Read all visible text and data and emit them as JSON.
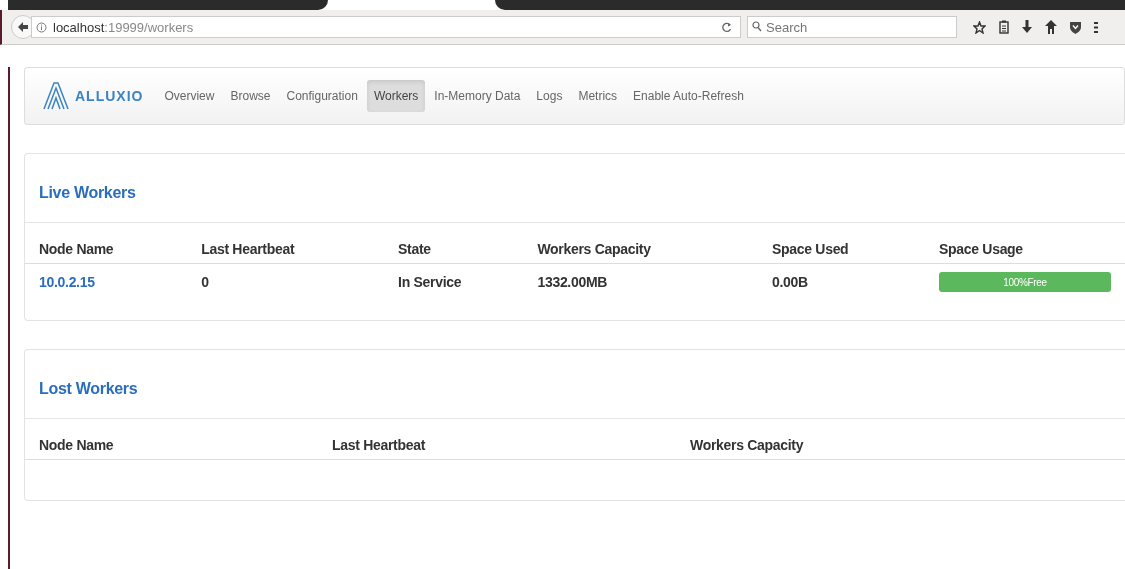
{
  "browser": {
    "url_host": "localhost",
    "url_path": ":19999/workers",
    "search": {
      "placeholder": "Search"
    }
  },
  "navbar": {
    "brand": "ALLUXIO",
    "items": [
      {
        "label": "Overview",
        "selected": false
      },
      {
        "label": "Browse",
        "selected": false
      },
      {
        "label": "Configuration",
        "selected": false
      },
      {
        "label": "Workers",
        "selected": true
      },
      {
        "label": "In-Memory Data",
        "selected": false
      },
      {
        "label": "Logs",
        "selected": false
      },
      {
        "label": "Metrics",
        "selected": false
      },
      {
        "label": "Enable Auto-Refresh",
        "selected": false
      }
    ]
  },
  "live_workers": {
    "title": "Live Workers",
    "columns": [
      "Node Name",
      "Last Heartbeat",
      "State",
      "Workers Capacity",
      "Space Used",
      "Space Usage"
    ],
    "rows": [
      {
        "node_name": "10.0.2.15",
        "last_heartbeat": "0",
        "state": "In Service",
        "capacity": "1332.00MB",
        "space_used": "0.00B",
        "usage": {
          "label": "100%Free",
          "level": 1
        }
      }
    ]
  },
  "lost_workers": {
    "title": "Lost Workers",
    "columns": [
      "Node Name",
      "Last Heartbeat",
      "Workers Capacity"
    ]
  }
}
